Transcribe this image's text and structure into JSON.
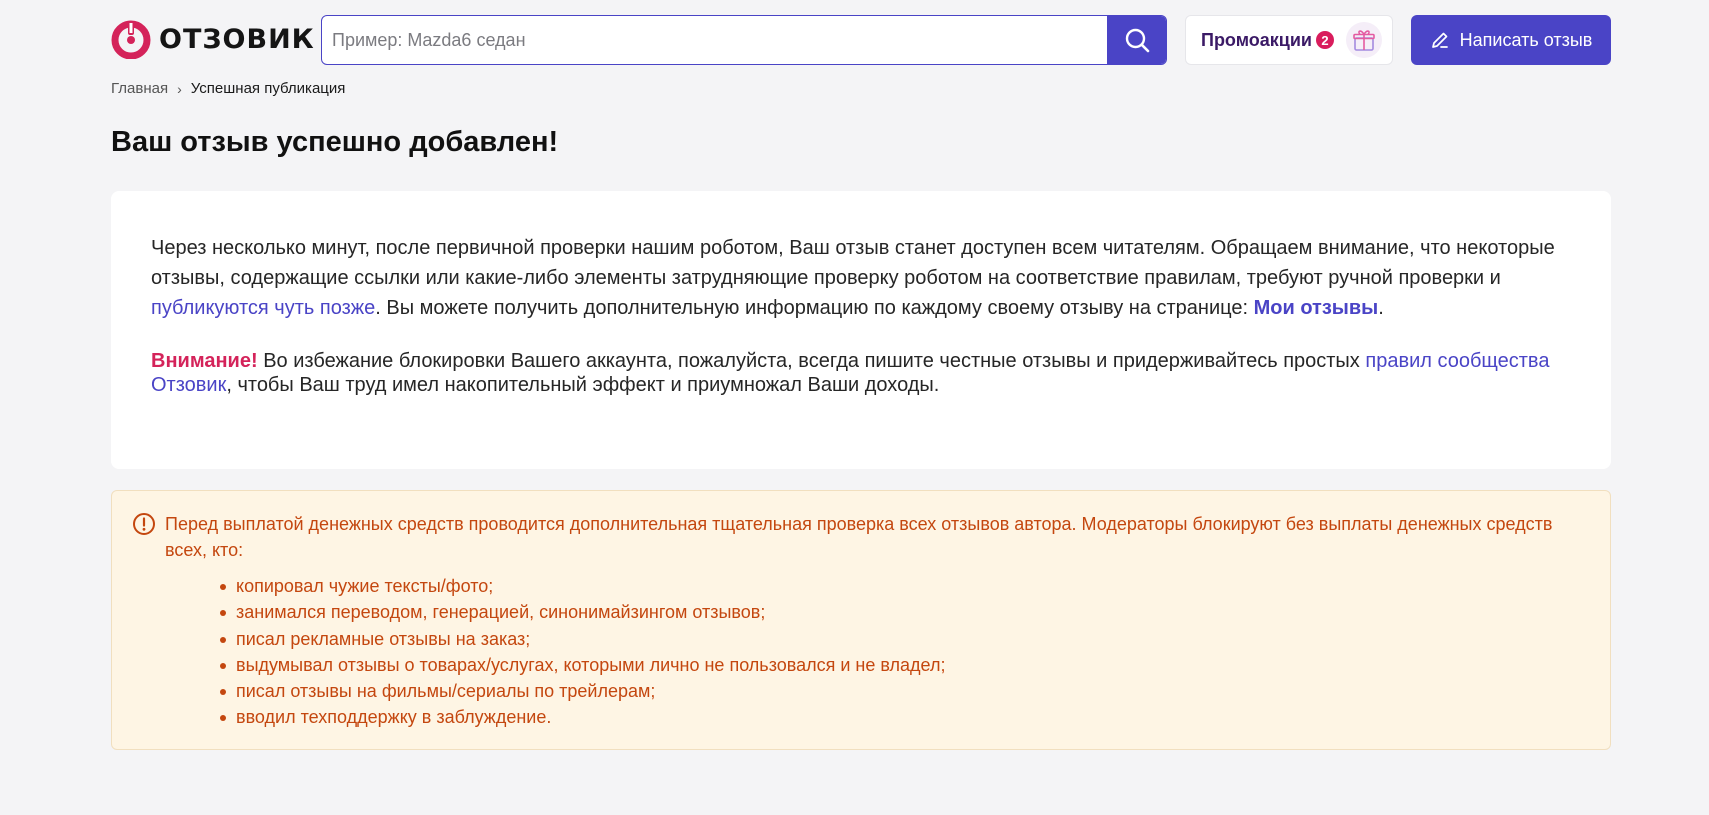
{
  "header": {
    "logo_text": "ОТЗОВИК",
    "search_placeholder": "Пример: Mazda6 седан",
    "promo_label": "Промоакции",
    "promo_count": "2",
    "write_button": "Написать отзыв"
  },
  "breadcrumb": {
    "home": "Главная",
    "separator": "›",
    "current": "Успешная публикация"
  },
  "page_title": "Ваш отзыв успешно добавлен!",
  "message": {
    "part1": "Через несколько минут, после первичной проверки нашим роботом, Ваш отзыв станет доступен всем читателям. Обращаем внимание, что некоторые отзывы, содержащие ссылки или какие-либо элементы затрудняющие проверку роботом на соответствие правилам, требуют ручной проверки и ",
    "link_later": "публикуются чуть позже",
    "part2": ". Вы можете получить дополнительную информацию по каждому своему отзыву на странице: ",
    "link_my_reviews": "Мои отзывы",
    "part3": "."
  },
  "attention": {
    "label": "Внимание!",
    "part1": " Во избежание блокировки Вашего аккаунта, пожалуйста, всегда пишите честные отзывы и придерживайтесь простых ",
    "link_rules": "правил сообщества Отзовик",
    "part2": ", чтобы Ваш труд имел накопительный эффект и приумножал Ваши доходы."
  },
  "warning": {
    "intro": "Перед выплатой денежных средств проводится дополнительная тщательная проверка всех отзывов автора. Модераторы блокируют без выплаты денежных средств всех, кто:",
    "items": [
      "копировал чужие тексты/фото;",
      "занимался переводом, генерацией, синонимайзингом отзывов;",
      "писал рекламные отзывы на заказ;",
      "выдумывал отзывы о товарах/услугах, которыми лично не пользовался и не владел;",
      "писал отзывы на фильмы/сериалы по трейлерам;",
      "вводил техподдержку в заблуждение."
    ]
  },
  "colors": {
    "accent": "#4a44c6",
    "brand": "#d4235a",
    "warning_text": "#c4470f",
    "warning_bg": "#fef5e4",
    "page_bg": "#f4f4f6"
  }
}
